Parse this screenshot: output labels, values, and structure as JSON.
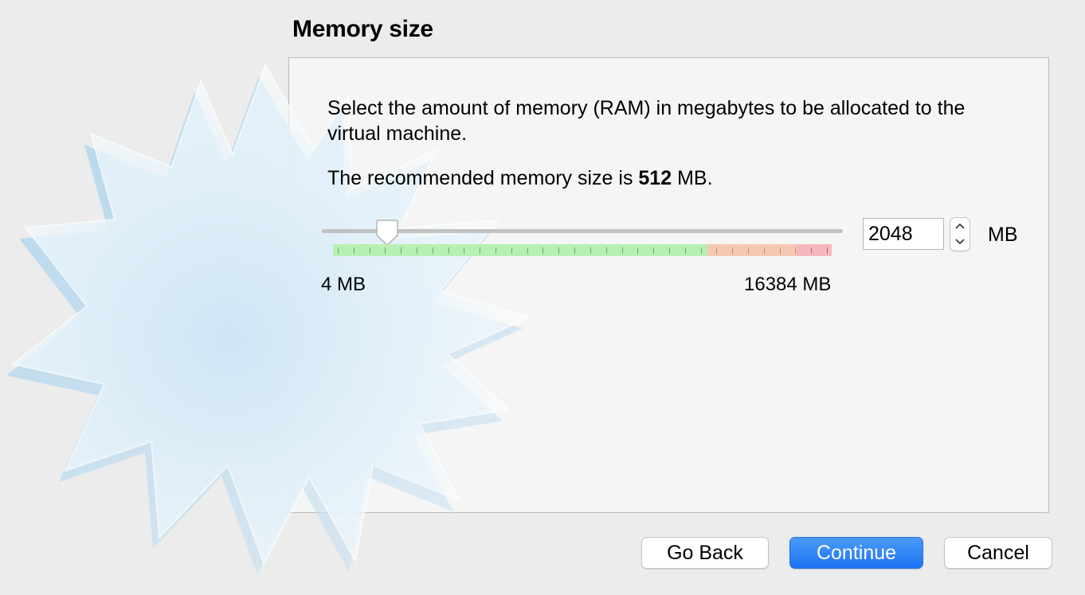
{
  "header": {
    "title": "Memory size"
  },
  "main": {
    "description": "Select the amount of memory (RAM) in megabytes to be allocated to the virtual machine.",
    "recommended_prefix": "The recommended memory size is ",
    "recommended_value": "512",
    "recommended_suffix": " MB."
  },
  "memory": {
    "value": "2048",
    "unit": "MB",
    "min_label": "4 MB",
    "max_label": "16384 MB",
    "slider_fraction": 0.125,
    "scale_green_fraction": 0.75,
    "scale_orange_fraction": 0.18,
    "scale_red_fraction": 0.07
  },
  "colors": {
    "accent": "#1d72f3",
    "scale_green": "#b8f0b3",
    "scale_orange": "#f5c9b3",
    "scale_red": "#f7b8bd"
  },
  "footer": {
    "back_label": "Go Back",
    "continue_label": "Continue",
    "cancel_label": "Cancel"
  },
  "icons": {
    "watermark": "starburst-watermark-icon",
    "stepper_up": "chevron-up-icon",
    "stepper_down": "chevron-down-icon"
  }
}
